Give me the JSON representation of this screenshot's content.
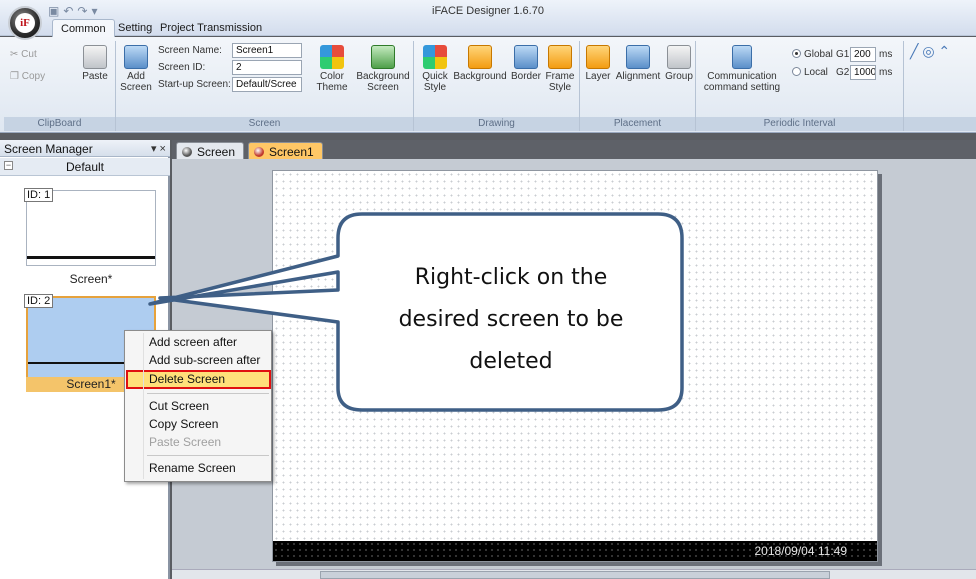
{
  "window": {
    "title": "iFACE Designer 1.6.70"
  },
  "ribbon_tabs": [
    "Common",
    "Setting",
    "Project Transmission"
  ],
  "clipboard": {
    "cut": "Cut",
    "copy": "Copy",
    "paste": "Paste",
    "label": "ClipBoard"
  },
  "screen_group": {
    "add_screen": "Add",
    "add_screen2": "Screen",
    "name_label": "Screen Name:",
    "name_value": "Screen1",
    "id_label": "Screen ID:",
    "id_value": "2",
    "startup_label": "Start-up Screen:",
    "startup_value": "Default/Scree",
    "color_theme": "Color",
    "color_theme2": "Theme",
    "background_screen": "Background",
    "background_screen2": "Screen",
    "label": "Screen"
  },
  "drawing": {
    "quick_style": "Quick",
    "quick_style2": "Style",
    "background": "Background",
    "border": "Border",
    "frame_style": "Frame",
    "frame_style2": "Style",
    "label": "Drawing"
  },
  "placement": {
    "layer": "Layer",
    "alignment": "Alignment",
    "group": "Group",
    "label": "Placement"
  },
  "comm": {
    "line1": "Communication",
    "line2": "command setting"
  },
  "periodic": {
    "global": "Global",
    "local": "Local",
    "g1_label": "G1",
    "g1_value": "200",
    "g2_label": "G2",
    "g2_value": "1000",
    "unit": "ms",
    "label": "Periodic Interval"
  },
  "screen_manager": {
    "title": "Screen Manager",
    "controls": "▾ ×",
    "group": "Default",
    "screens": [
      {
        "id": "ID: 1",
        "caption": "Screen*"
      },
      {
        "id": "ID: 2",
        "caption": "Screen1*"
      }
    ]
  },
  "doc_tabs": [
    "Screen",
    "Screen1"
  ],
  "canvas": {
    "status_text": "2018/09/04   11:49"
  },
  "context_menu": {
    "items": [
      "Add screen after",
      "Add sub-screen after",
      "Delete Screen",
      "Cut Screen",
      "Copy Screen",
      "Paste Screen",
      "Rename Screen"
    ]
  },
  "callout": {
    "line1": "Right-click on the",
    "line2": "desired screen to be",
    "line3": "deleted"
  },
  "colors": {
    "highlight": "#e01010",
    "accent_tab": "#ffc766",
    "callout_border": "#3f5f86"
  }
}
